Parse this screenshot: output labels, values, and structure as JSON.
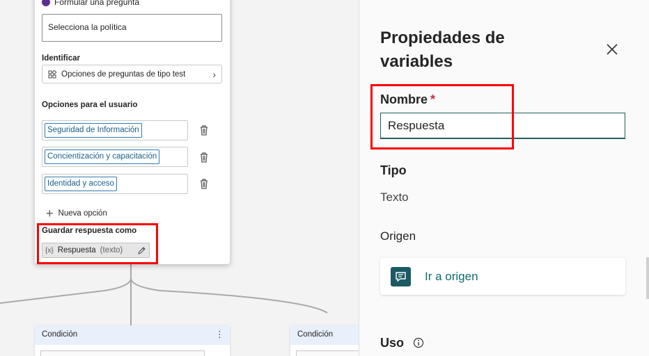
{
  "canvas": {
    "question_card": {
      "header_label": "Formular una pregunta",
      "policy_text": "Selecciona la política",
      "identify_label": "Identificar",
      "identify_button": "Opciones de preguntas de tipo test",
      "user_options_label": "Opciones para el usuario",
      "options": [
        "Seguridad de Información",
        "Concientización y capacitación",
        "Identidad y acceso"
      ],
      "new_option_label": "Nueva opción",
      "save_label": "Guardar respuesta como",
      "save_var_prefix": "{x}",
      "save_var_name": "Respuesta",
      "save_var_type": "(texto)"
    },
    "conditions": [
      "Condición",
      "Condición"
    ]
  },
  "panel": {
    "title": "Propiedades de variables",
    "name_label": "Nombre",
    "required_mark": "*",
    "name_value": "Respuesta",
    "type_label": "Tipo",
    "type_value": "Texto",
    "origin_label": "Origen",
    "origin_link": "Ir a origen",
    "usage_label": "Uso"
  },
  "colors": {
    "highlight": "#ff0000",
    "accent_teal": "#1f5e59",
    "link_teal": "#0f6b6e",
    "chip_blue": "#2e7bb0"
  }
}
